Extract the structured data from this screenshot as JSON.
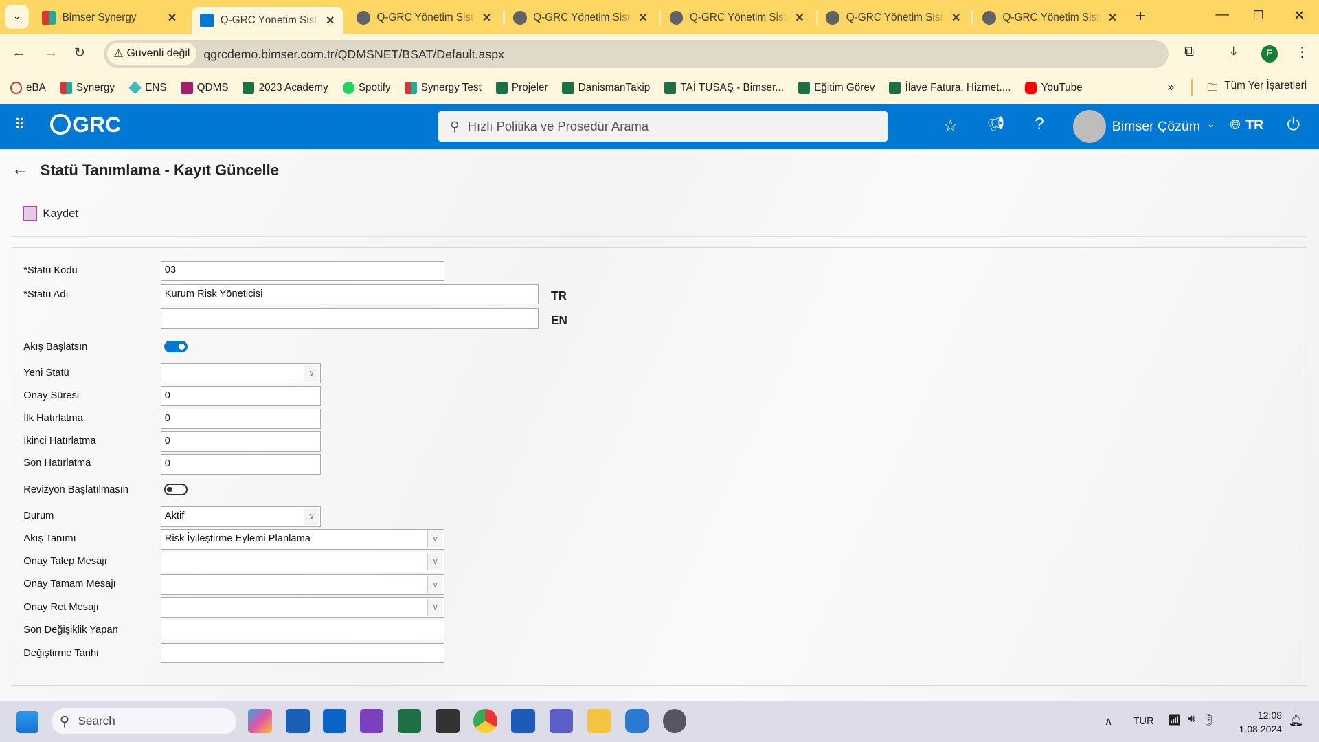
{
  "browser": {
    "tabs": [
      {
        "title": "Bimser Synergy",
        "active": false
      },
      {
        "title": "Q-GRC Yönetim Sistemi",
        "active": true
      },
      {
        "title": "Q-GRC Yönetim Sistemi",
        "active": false
      },
      {
        "title": "Q-GRC Yönetim Sistemi",
        "active": false
      },
      {
        "title": "Q-GRC Yönetim Sistemi",
        "active": false
      },
      {
        "title": "Q-GRC Yönetim Sistemi",
        "active": false
      },
      {
        "title": "Q-GRC Yönetim Sistemi",
        "active": false
      }
    ],
    "security_label": "Güvenli değil",
    "url": "qgrcdemo.bimser.com.tr/QDMSNET/BSAT/Default.aspx",
    "profile_initial": "E",
    "bookmarks": [
      "eBA",
      "Synergy",
      "ENS",
      "QDMS",
      "2023 Academy",
      "Spotify",
      "Synergy Test",
      "Projeler",
      "DanismanTakip",
      "TAİ TUSAŞ - Bimser...",
      "Eğitim Görev",
      "İlave Fatura. Hizmet....",
      "YouTube"
    ],
    "all_bookmarks": "Tüm Yer İşaretleri"
  },
  "app": {
    "logo": "QGRC",
    "search_placeholder": "Hızlı Politika ve Prosedür Arama",
    "user": "Bimser Çözüm",
    "language": "TR",
    "brand_color": "#0078d4"
  },
  "page": {
    "title": "Statü Tanımlama - Kayıt Güncelle",
    "save_label": "Kaydet"
  },
  "form": {
    "status_code": {
      "label": "*Statü Kodu",
      "value": "03"
    },
    "status_name": {
      "label": "*Statü Adı",
      "value_tr": "Kurum Risk Yöneticisi",
      "value_en": "",
      "tr": "TR",
      "en": "EN"
    },
    "start_flow": {
      "label": "Akış Başlatsın",
      "on": true
    },
    "new_status": {
      "label": "Yeni Statü",
      "value": ""
    },
    "approval_duration": {
      "label": "Onay Süresi",
      "value": "0"
    },
    "first_reminder": {
      "label": "İlk Hatırlatma",
      "value": "0"
    },
    "second_reminder": {
      "label": "İkinci Hatırlatma",
      "value": "0"
    },
    "last_reminder": {
      "label": "Son Hatırlatma",
      "value": "0"
    },
    "no_revision": {
      "label": "Revizyon Başlatılmasın",
      "on": false
    },
    "state": {
      "label": "Durum",
      "value": "Aktif"
    },
    "flow_definition": {
      "label": "Akış Tanımı",
      "value": "Risk İyileştirme Eylemi Planlama"
    },
    "approval_request_msg": {
      "label": "Onay Talep Mesajı",
      "value": ""
    },
    "approval_done_msg": {
      "label": "Onay Tamam Mesajı",
      "value": ""
    },
    "approval_reject_msg": {
      "label": "Onay Ret Mesajı",
      "value": ""
    },
    "last_modified_by": {
      "label": "Son Değişiklik Yapan",
      "value": ""
    },
    "modified_date": {
      "label": "Değiştirme Tarihi",
      "value": ""
    }
  },
  "taskbar": {
    "search_placeholder": "Search",
    "lang": "TUR",
    "time": "12:08",
    "date": "1.08.2024"
  }
}
